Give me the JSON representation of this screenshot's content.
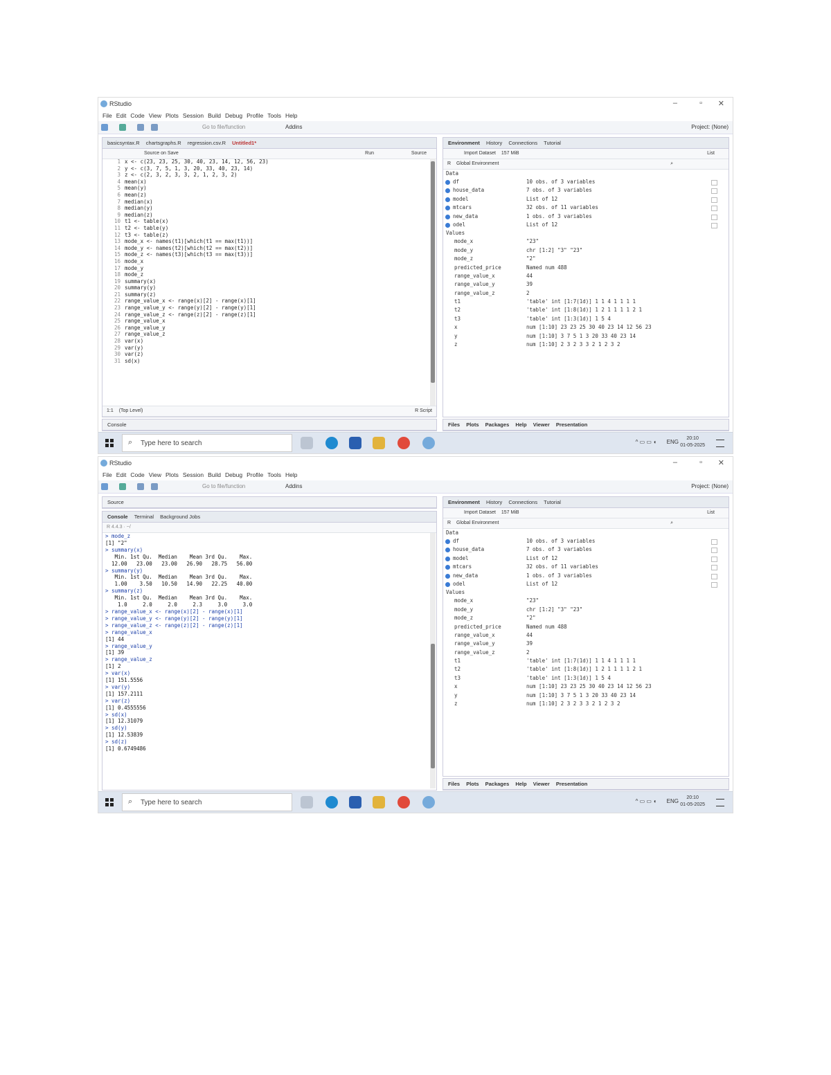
{
  "shot1": {
    "app_title": "RStudio",
    "menu": [
      "File",
      "Edit",
      "Code",
      "View",
      "Plots",
      "Session",
      "Build",
      "Debug",
      "Profile",
      "Tools",
      "Help"
    ],
    "goto_placeholder": "Go to file/function",
    "addins": "Addins",
    "project": "Project: (None)",
    "editor_tabs": [
      "basicsyntax.R",
      "chartsgraphs.R",
      "regression.csv.R",
      "Untitled1*"
    ],
    "source_on_save": "Source on Save",
    "run": "Run",
    "source": "Source",
    "code_lines": [
      "x <- c(23, 23, 25, 30, 40, 23, 14, 12, 56, 23)",
      "y <- c(3, 7, 5, 1, 3, 20, 33, 40, 23, 14)",
      "z <- c(2, 3, 2, 3, 3, 2, 1, 2, 3, 2)",
      "mean(x)",
      "mean(y)",
      "mean(z)",
      "median(x)",
      "median(y)",
      "median(z)",
      "t1 <- table(x)",
      "t2 <- table(y)",
      "t3 <- table(z)",
      "mode_x <- names(t1)[which(t1 == max(t1))]",
      "mode_y <- names(t2)[which(t2 == max(t2))]",
      "mode_z <- names(t3)[which(t3 == max(t3))]",
      "mode_x",
      "mode_y",
      "mode_z",
      "summary(x)",
      "summary(y)",
      "summary(z)",
      "range_value_x <- range(x)[2] - range(x)[1]",
      "range_value_y <- range(y)[2] - range(y)[1]",
      "range_value_z <- range(z)[2] - range(z)[1]",
      "range_value_x",
      "range_value_y",
      "range_value_z",
      "var(x)",
      "var(y)",
      "var(z)",
      "sd(x)"
    ],
    "status_pos": "1:1",
    "status_level": "(Top Level)",
    "status_type": "R Script",
    "console_label": "Console",
    "env_tabs": [
      "Environment",
      "History",
      "Connections",
      "Tutorial"
    ],
    "import_dataset": "Import Dataset",
    "mem": "157 MiB",
    "list_label": "List",
    "r_label": "R",
    "global_env": "Global Environment",
    "data_label": "Data",
    "values_label": "Values",
    "data_rows": [
      {
        "name": "df",
        "value": "10 obs. of 3 variables"
      },
      {
        "name": "house_data",
        "value": "7 obs. of 3 variables"
      },
      {
        "name": "model",
        "value": "List of 12"
      },
      {
        "name": "mtcars",
        "value": "32 obs. of 11 variables"
      },
      {
        "name": "new_data",
        "value": "1 obs. of 3 variables"
      },
      {
        "name": "odel",
        "value": "List of 12"
      }
    ],
    "value_rows": [
      {
        "name": "mode_x",
        "value": "\"23\""
      },
      {
        "name": "mode_y",
        "value": "chr [1:2] \"3\" \"23\""
      },
      {
        "name": "mode_z",
        "value": "\"2\""
      },
      {
        "name": "predicted_price",
        "value": "Named num 488"
      },
      {
        "name": "range_value_x",
        "value": "44"
      },
      {
        "name": "range_value_y",
        "value": "39"
      },
      {
        "name": "range_value_z",
        "value": "2"
      },
      {
        "name": "t1",
        "value": "'table' int [1:7(1d)] 1 1 4 1 1 1 1"
      },
      {
        "name": "t2",
        "value": "'table' int [1:8(1d)] 1 2 1 1 1 1 2 1"
      },
      {
        "name": "t3",
        "value": "'table' int [1:3(1d)] 1 5 4"
      },
      {
        "name": "x",
        "value": "num [1:10] 23 23 25 30 40 23 14 12 56 23"
      },
      {
        "name": "y",
        "value": "num [1:10] 3 7 5 1 3 20 33 40 23 14"
      },
      {
        "name": "z",
        "value": "num [1:10] 2 3 2 3 3 2 1 2 3 2"
      }
    ],
    "files_tabs": [
      "Files",
      "Plots",
      "Packages",
      "Help",
      "Viewer",
      "Presentation"
    ],
    "search_placeholder": "Type here to search",
    "lang": "ENG",
    "time": "20:10",
    "date": "01-05-2025"
  },
  "shot2": {
    "app_title": "RStudio",
    "menu": [
      "File",
      "Edit",
      "Code",
      "View",
      "Plots",
      "Session",
      "Build",
      "Debug",
      "Profile",
      "Tools",
      "Help"
    ],
    "goto_placeholder": "Go to file/function",
    "addins": "Addins",
    "project": "Project: (None)",
    "source_label": "Source",
    "console_tabs": [
      "Console",
      "Terminal",
      "Background Jobs"
    ],
    "r_version": "R 4.4.3 · ~/",
    "console_lines": [
      {
        "t": "> mode_z",
        "k": "cmd"
      },
      {
        "t": "[1] \"2\"",
        "k": "out"
      },
      {
        "t": "> summary(x)",
        "k": "cmd"
      },
      {
        "t": "   Min. 1st Qu.  Median    Mean 3rd Qu.    Max. ",
        "k": "out"
      },
      {
        "t": "  12.00   23.00   23.00   26.90   28.75   56.00 ",
        "k": "out"
      },
      {
        "t": "> summary(y)",
        "k": "cmd"
      },
      {
        "t": "   Min. 1st Qu.  Median    Mean 3rd Qu.    Max. ",
        "k": "out"
      },
      {
        "t": "   1.00    3.50   10.50   14.90   22.25   40.00 ",
        "k": "out"
      },
      {
        "t": "> summary(z)",
        "k": "cmd"
      },
      {
        "t": "   Min. 1st Qu.  Median    Mean 3rd Qu.    Max. ",
        "k": "out"
      },
      {
        "t": "    1.0     2.0     2.0     2.3     3.0     3.0 ",
        "k": "out"
      },
      {
        "t": "> range_value_x <- range(x)[2] - range(x)[1]",
        "k": "cmd"
      },
      {
        "t": "> range_value_y <- range(y)[2] - range(y)[1]",
        "k": "cmd"
      },
      {
        "t": "> range_value_z <- range(z)[2] - range(z)[1]",
        "k": "cmd"
      },
      {
        "t": "> range_value_x",
        "k": "cmd"
      },
      {
        "t": "[1] 44",
        "k": "out"
      },
      {
        "t": "> range_value_y",
        "k": "cmd"
      },
      {
        "t": "[1] 39",
        "k": "out"
      },
      {
        "t": "> range_value_z",
        "k": "cmd"
      },
      {
        "t": "[1] 2",
        "k": "out"
      },
      {
        "t": "> var(x)",
        "k": "cmd"
      },
      {
        "t": "[1] 151.5556",
        "k": "out"
      },
      {
        "t": "> var(y)",
        "k": "cmd"
      },
      {
        "t": "[1] 157.2111",
        "k": "out"
      },
      {
        "t": "> var(z)",
        "k": "cmd"
      },
      {
        "t": "[1] 0.4555556",
        "k": "out"
      },
      {
        "t": "> sd(x)",
        "k": "cmd"
      },
      {
        "t": "[1] 12.31079",
        "k": "out"
      },
      {
        "t": "> sd(y)",
        "k": "cmd"
      },
      {
        "t": "[1] 12.53839",
        "k": "out"
      },
      {
        "t": "> sd(z)",
        "k": "cmd"
      },
      {
        "t": "[1] 0.6749486",
        "k": "out"
      }
    ],
    "env_tabs": [
      "Environment",
      "History",
      "Connections",
      "Tutorial"
    ],
    "import_dataset": "Import Dataset",
    "mem": "157 MiB",
    "list_label": "List",
    "r_label": "R",
    "global_env": "Global Environment",
    "data_label": "Data",
    "values_label": "Values",
    "data_rows": [
      {
        "name": "df",
        "value": "10 obs. of 3 variables"
      },
      {
        "name": "house_data",
        "value": "7 obs. of 3 variables"
      },
      {
        "name": "model",
        "value": "List of 12"
      },
      {
        "name": "mtcars",
        "value": "32 obs. of 11 variables"
      },
      {
        "name": "new_data",
        "value": "1 obs. of 3 variables"
      },
      {
        "name": "odel",
        "value": "List of 12"
      }
    ],
    "value_rows": [
      {
        "name": "mode_x",
        "value": "\"23\""
      },
      {
        "name": "mode_y",
        "value": "chr [1:2] \"3\" \"23\""
      },
      {
        "name": "mode_z",
        "value": "\"2\""
      },
      {
        "name": "predicted_price",
        "value": "Named num 488"
      },
      {
        "name": "range_value_x",
        "value": "44"
      },
      {
        "name": "range_value_y",
        "value": "39"
      },
      {
        "name": "range_value_z",
        "value": "2"
      },
      {
        "name": "t1",
        "value": "'table' int [1:7(1d)] 1 1 4 1 1 1 1"
      },
      {
        "name": "t2",
        "value": "'table' int [1:8(1d)] 1 2 1 1 1 1 2 1"
      },
      {
        "name": "t3",
        "value": "'table' int [1:3(1d)] 1 5 4"
      },
      {
        "name": "x",
        "value": "num [1:10] 23 23 25 30 40 23 14 12 56 23"
      },
      {
        "name": "y",
        "value": "num [1:10] 3 7 5 1 3 20 33 40 23 14"
      },
      {
        "name": "z",
        "value": "num [1:10] 2 3 2 3 3 2 1 2 3 2"
      }
    ],
    "files_tabs": [
      "Files",
      "Plots",
      "Packages",
      "Help",
      "Viewer",
      "Presentation"
    ],
    "search_placeholder": "Type here to search",
    "lang": "ENG",
    "time": "20:10",
    "date": "01-05-2025"
  },
  "colors": {
    "accent": "#75aadb",
    "console_cmd": "#1a3ea8",
    "taskbar": "#dfe6f0"
  }
}
